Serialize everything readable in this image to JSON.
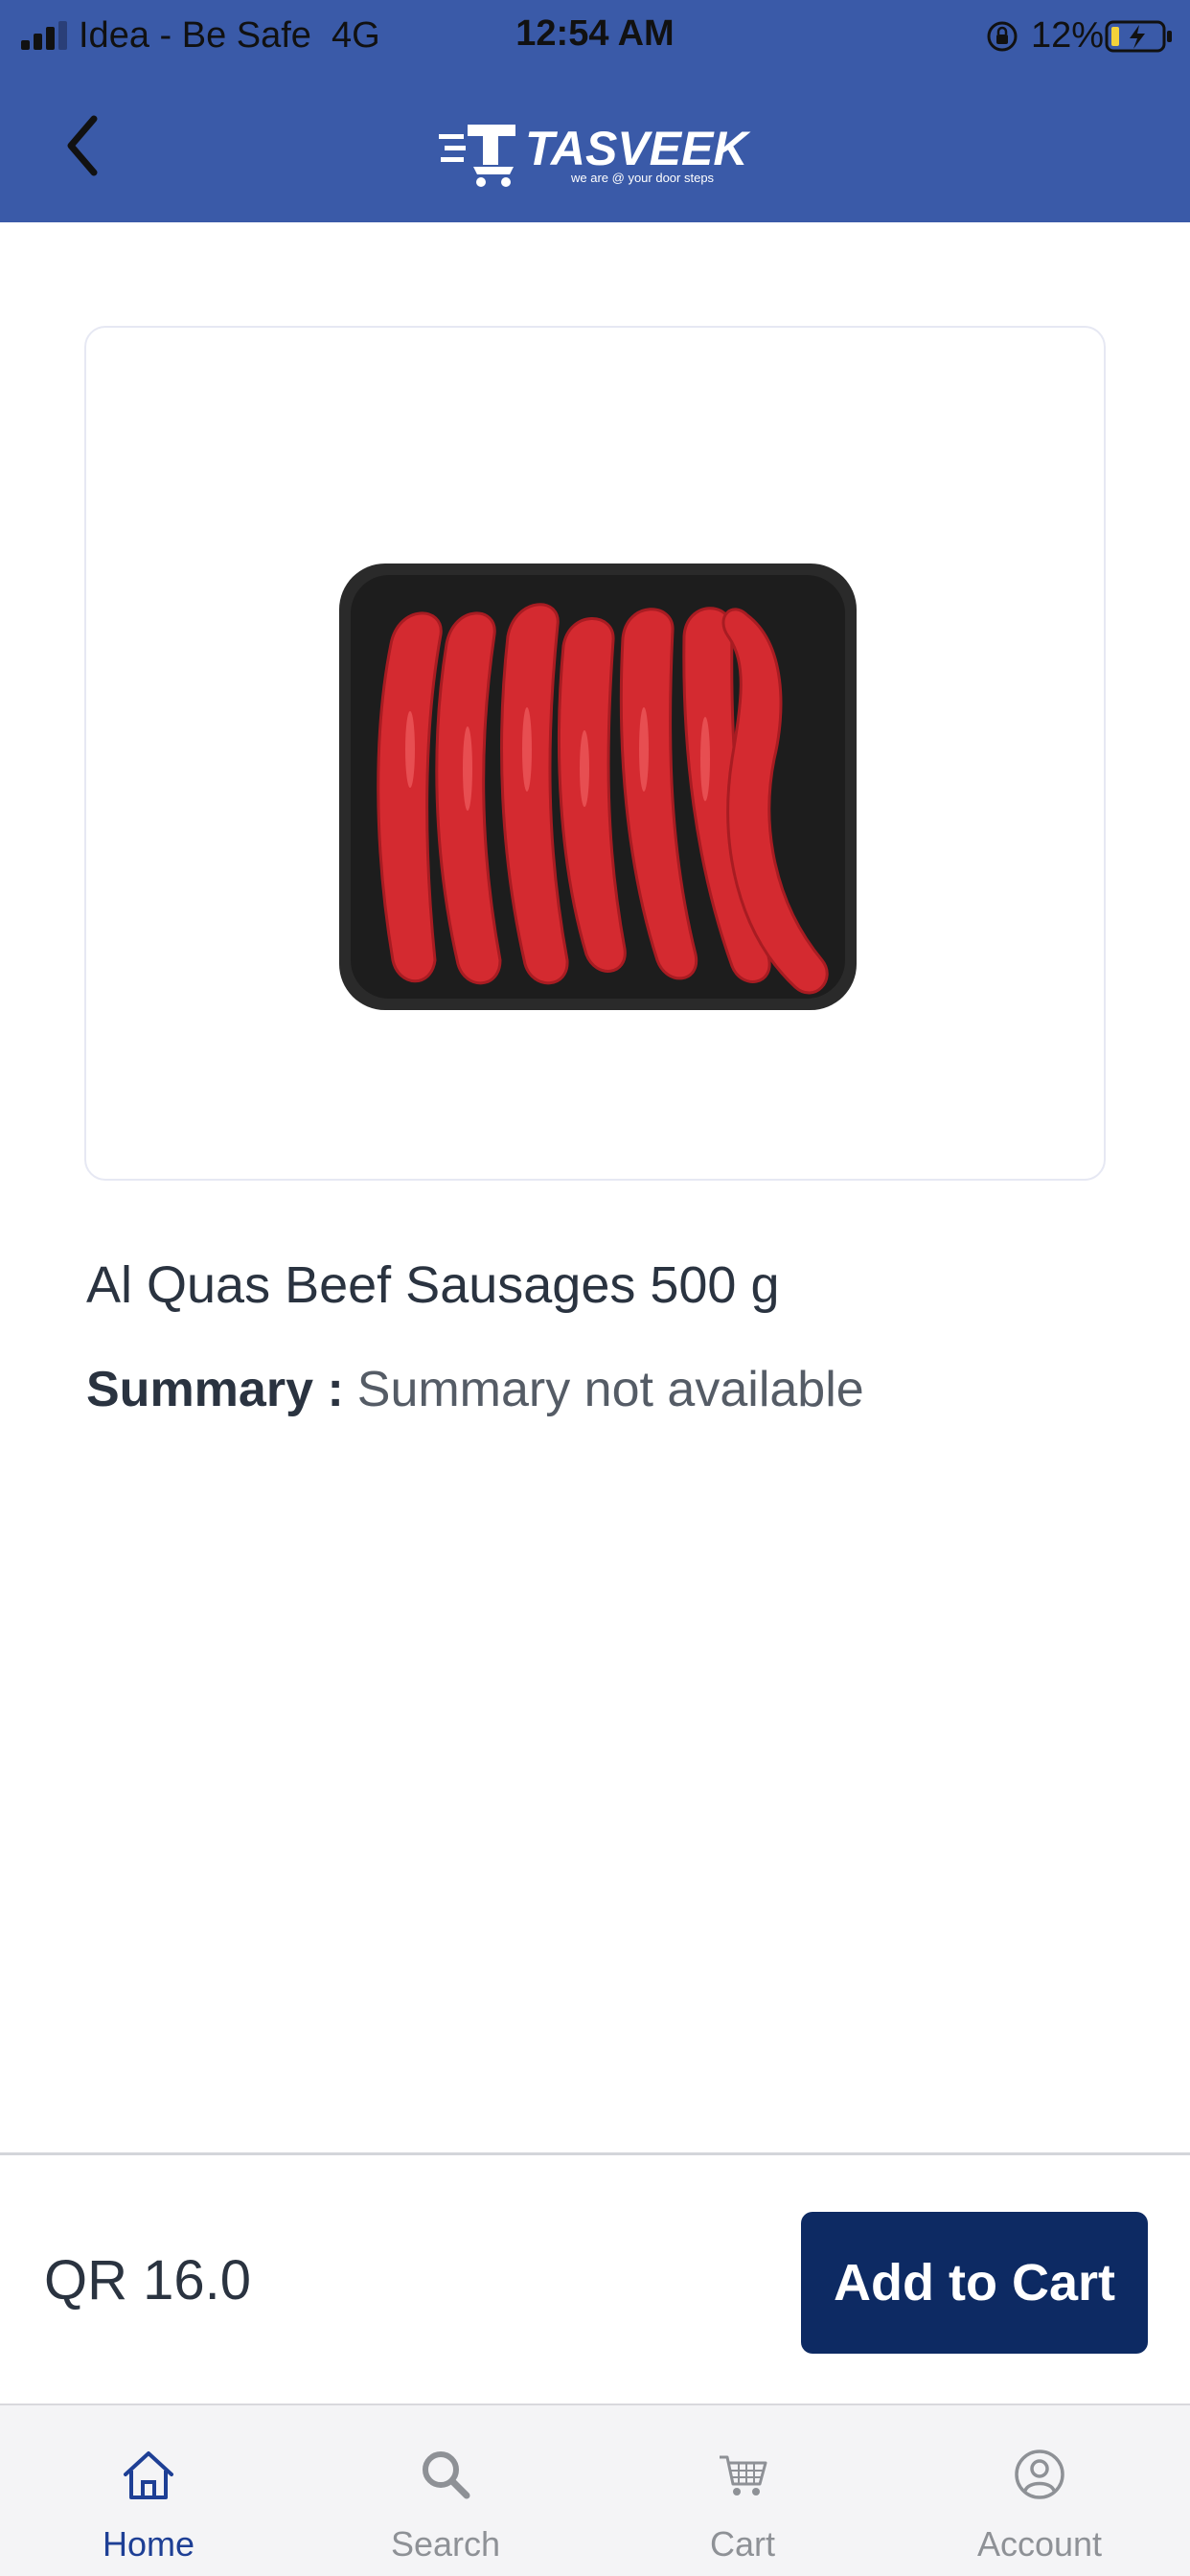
{
  "status_bar": {
    "carrier": "Idea - Be Safe",
    "network": "4G",
    "time": "12:54 AM",
    "battery_percent": "12%"
  },
  "header": {
    "logo_text": "TASVEEK",
    "logo_tagline": "we are @ your door steps",
    "background_color": "#3a5aa8"
  },
  "product": {
    "name": "Al Quas Beef Sausages 500 g",
    "summary_label": "Summary :",
    "summary_value": "Summary not available",
    "image_icon": "beef-sausages-tray"
  },
  "purchase_bar": {
    "price": "QR 16.0",
    "add_to_cart_label": "Add to Cart",
    "button_color": "#0d2a63"
  },
  "tabs": [
    {
      "label": "Home",
      "icon": "home-icon",
      "active": true
    },
    {
      "label": "Search",
      "icon": "search-icon",
      "active": false
    },
    {
      "label": "Cart",
      "icon": "cart-icon",
      "active": false
    },
    {
      "label": "Account",
      "icon": "account-icon",
      "active": false
    }
  ]
}
